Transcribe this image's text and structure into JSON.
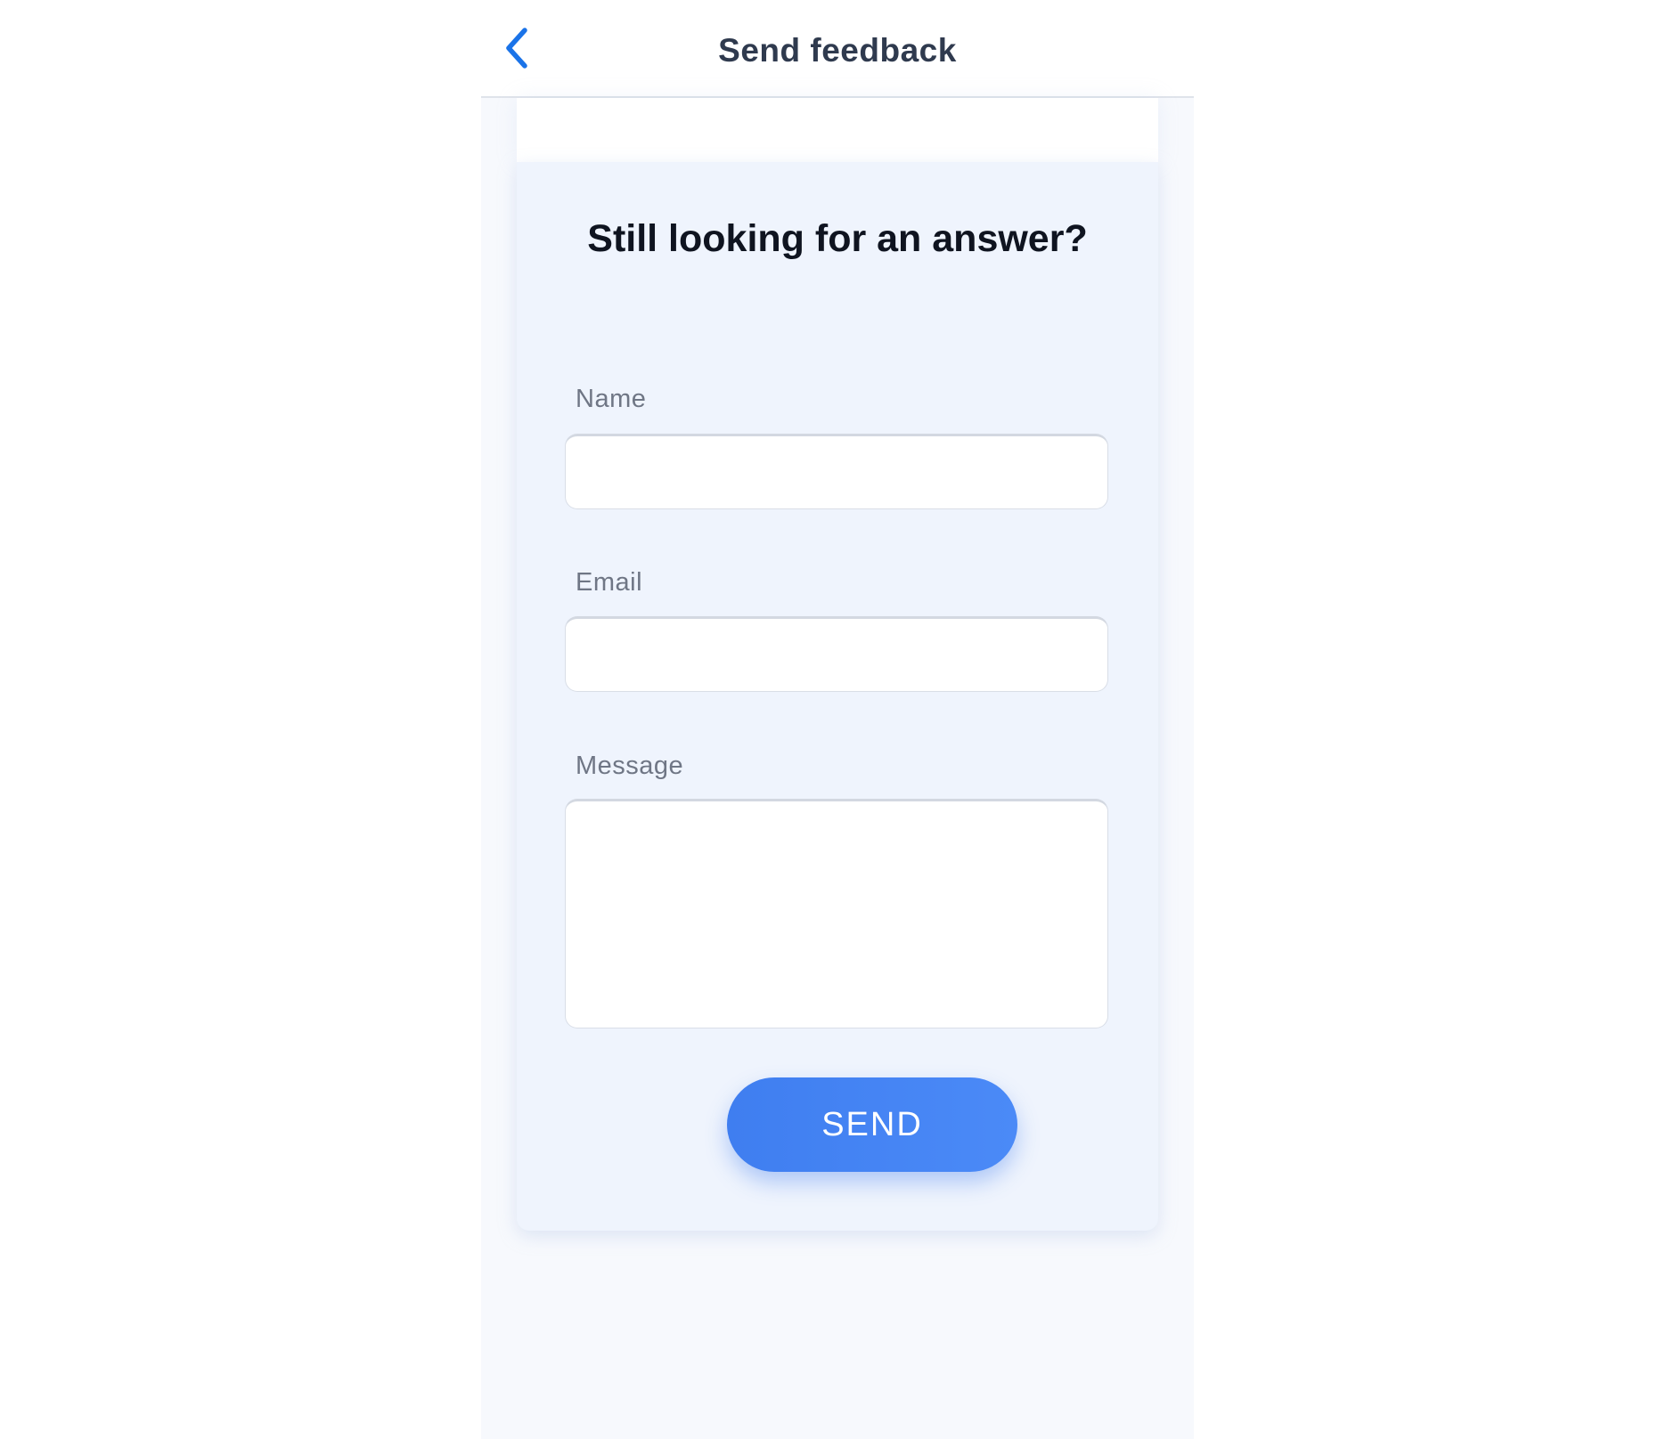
{
  "header": {
    "title": "Send feedback",
    "back_icon": "chevron-left-icon",
    "accent_color": "#1a73e8"
  },
  "card": {
    "heading": "Still looking for an answer?"
  },
  "form": {
    "name_label": "Name",
    "name_value": "",
    "email_label": "Email",
    "email_value": "",
    "message_label": "Message",
    "message_value": "",
    "send_label": "SEND",
    "send_color": "#4285f4"
  }
}
